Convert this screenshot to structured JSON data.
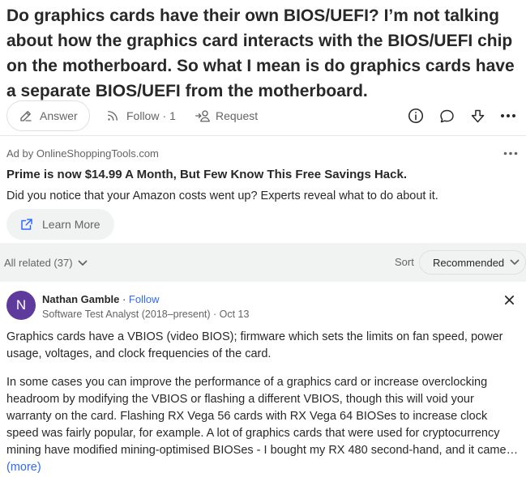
{
  "question": {
    "title": "Do graphics cards have their own BIOS/UEFI? I’m not talking about how the graphics card interacts with the BIOS/UEFI chip on the motherboard. So what I mean is do graphics cards have a separate BIOS/UEFI from the motherboard."
  },
  "actions": {
    "answer_label": "Answer",
    "follow_label": "Follow",
    "follow_separator": "·",
    "follow_count": "1",
    "request_label": "Request",
    "icons": [
      "info-icon",
      "comment-icon",
      "downvote-icon",
      "more-icon"
    ]
  },
  "ad": {
    "by": "Ad by OnlineShoppingTools.com",
    "title": "Prime is now $14.99 A Month, But Few Know This Free Savings Hack.",
    "description": "Did you notice that your Amazon costs went up? Experts reveal what to do about it.",
    "button_label": "Learn More"
  },
  "related": {
    "label": "All related (37)",
    "sort_label": "Sort",
    "sort_value": "Recommended"
  },
  "answer": {
    "avatar_initial": "N",
    "author": "Nathan Gamble",
    "separator": " · ",
    "follow": "Follow",
    "credential": "Software Test Analyst (2018–present) · Oct 13",
    "paragraph1": "Graphics cards have a VBIOS (video BIOS); firmware which sets the limits on fan speed, power usage, voltages, and clock frequencies of the card.",
    "paragraph2": "In some cases you can improve the performance of a graphics card or increase overclocking headroom by modifying the VBIOS or flashing a different VBIOS, though this will void your warranty on the card. Flashing RX Vega 56 cards with RX Vega 64 BIOSes to increase clock speed was fairly popular, for example. A lot of graphics cards that were used for cryptocurrency mining have modified mining-optimised BIOSes - I bought my RX 480 second-hand, and it came…",
    "more_label": "(more)"
  },
  "colors": {
    "text": "#282829",
    "muted": "#636466",
    "link": "#2e69ff",
    "avatar": "#5d3a9b",
    "band": "#f1f2f2"
  }
}
